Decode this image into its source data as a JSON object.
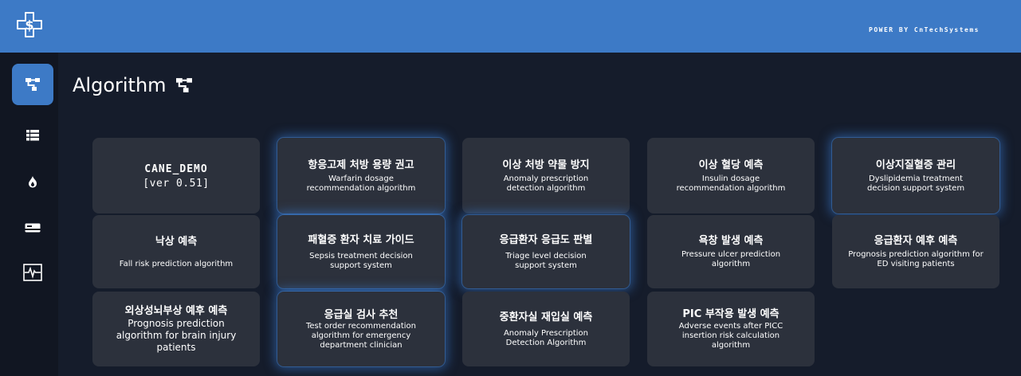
{
  "header": {
    "powered_by": "POWER BY CnTechSystems",
    "bg_color": "#3d7ac6"
  },
  "sidebar": {
    "items": [
      {
        "icon": "hierarchy-icon",
        "active": true
      },
      {
        "icon": "list-icon",
        "active": false
      },
      {
        "icon": "flame-icon",
        "active": false
      },
      {
        "icon": "card-icon",
        "active": false
      },
      {
        "icon": "heartbeat-icon",
        "active": false
      }
    ]
  },
  "main": {
    "title": "Algorithm",
    "title_icon": "hierarchy-icon",
    "cards": [
      {
        "title": "CANE_DEMO",
        "subtitle": "[ver 0.51]",
        "glow": false
      },
      {
        "title": "항응고제 처방 용량 권고",
        "subtitle": "Warfarin dosage recommendation algorithm",
        "glow": true
      },
      {
        "title": "이상 처방 약물 방지",
        "subtitle": "Anomaly prescription detection algorithm",
        "glow": false
      },
      {
        "title": "이상 혈당 예측",
        "subtitle": "Insulin dosage recommendation algorithm",
        "glow": false
      },
      {
        "title": "이상지질혈증 관리",
        "subtitle": "Dyslipidemia treatment decision support system",
        "glow": true
      },
      {
        "title": "낙상 예측",
        "subtitle": "Fall risk prediction algorithm",
        "glow": false
      },
      {
        "title": "패혈증 환자 치료 가이드",
        "subtitle": "Sepsis treatment decision support system",
        "glow": true
      },
      {
        "title": "응급환자 응급도 판별",
        "subtitle": "Triage level decision support system",
        "glow": true
      },
      {
        "title": "욕창 발생 예측",
        "subtitle": "Pressure ulcer prediction algorithm",
        "glow": false
      },
      {
        "title": "응급환자 예후 예측",
        "subtitle": "Prognosis prediction algorithm for ED visiting patients",
        "glow": false
      },
      {
        "title": "외상성뇌부상 예후 예측",
        "subtitle": "Prognosis prediction algorithm for brain injury patients",
        "glow": false
      },
      {
        "title": "응급실 검사 추천",
        "subtitle": "Test order recommendation algorithm for emergency department clinician",
        "glow": true
      },
      {
        "title": "중환자실 재입실 예측",
        "subtitle": "Anomaly Prescription Detection Algorithm",
        "glow": false
      },
      {
        "title": "PIC 부작용 발생 예측",
        "subtitle": "Adverse events after PICC insertion risk calculation algorithm",
        "glow": false
      }
    ]
  },
  "colors": {
    "background": "#151c2b",
    "sidebar": "#111622",
    "card": "#2c313c",
    "accent": "#3d7ac6",
    "glow": "#3c82dc"
  }
}
